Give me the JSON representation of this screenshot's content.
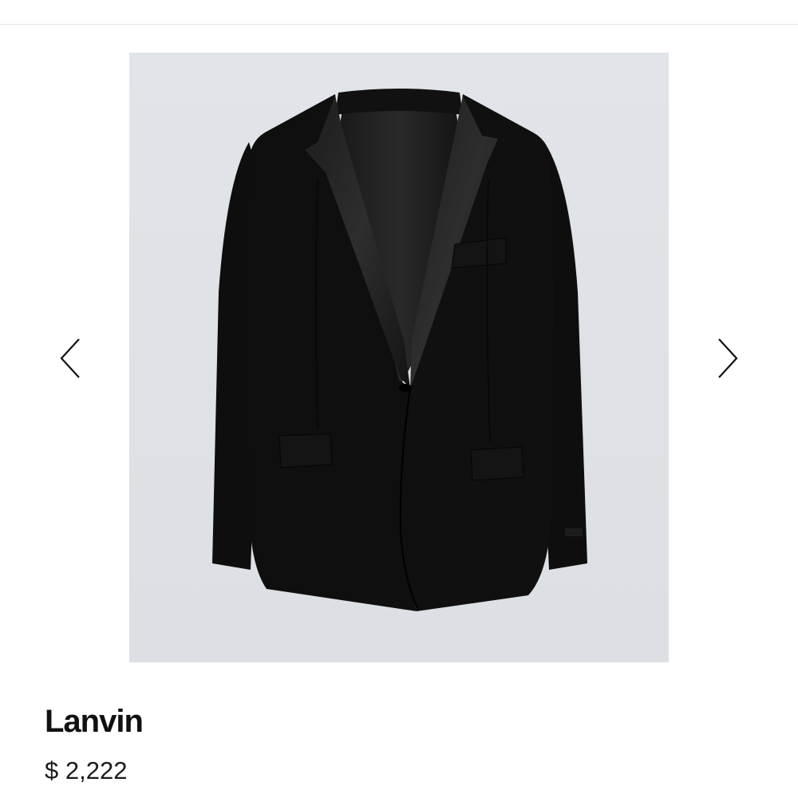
{
  "product": {
    "brand": "Lanvin",
    "price": "$ 2,222",
    "image_background": "#dfe2e6",
    "garment_color": "#0d0d0d"
  },
  "carousel": {
    "prev_icon": "chevron-left-icon",
    "next_icon": "chevron-right-icon"
  }
}
